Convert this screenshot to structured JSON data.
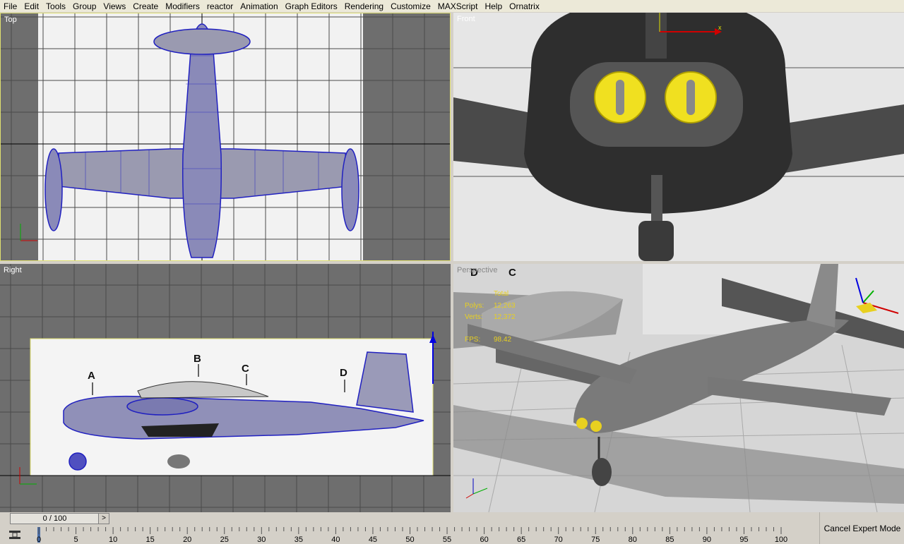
{
  "menu": [
    "File",
    "Edit",
    "Tools",
    "Group",
    "Views",
    "Create",
    "Modifiers",
    "reactor",
    "Animation",
    "Graph Editors",
    "Rendering",
    "Customize",
    "MAXScript",
    "Help",
    "Ornatrix"
  ],
  "viewports": {
    "top": {
      "label": "Top"
    },
    "front": {
      "label": "Front",
      "axis_x": "x"
    },
    "right": {
      "label": "Right",
      "markers": [
        "A",
        "B",
        "C",
        "D"
      ]
    },
    "perspective": {
      "label": "Perspective",
      "markers": [
        "D",
        "C"
      ],
      "stats": {
        "total_label": "Total",
        "polys_label": "Polys:",
        "polys_value": "12,263",
        "verts_label": "Verts:",
        "verts_value": "12,372",
        "fps_label": "FPS:",
        "fps_value": "98.42"
      }
    }
  },
  "axes": {
    "x": "x",
    "y": "y",
    "z": "z"
  },
  "timeline": {
    "slider_value": "0 / 100",
    "slider_arrow": ">",
    "ticks": [
      "0",
      "5",
      "10",
      "15",
      "20",
      "25",
      "30",
      "35",
      "40",
      "45",
      "50",
      "55",
      "60",
      "65",
      "70",
      "75",
      "80",
      "85",
      "90",
      "95",
      "100"
    ]
  },
  "cancel_expert_label": "Cancel Expert Mode",
  "colors": {
    "wireframe": "#2020c0",
    "selection": "#e0e070",
    "viewport_bg": "#6e6e6e"
  }
}
